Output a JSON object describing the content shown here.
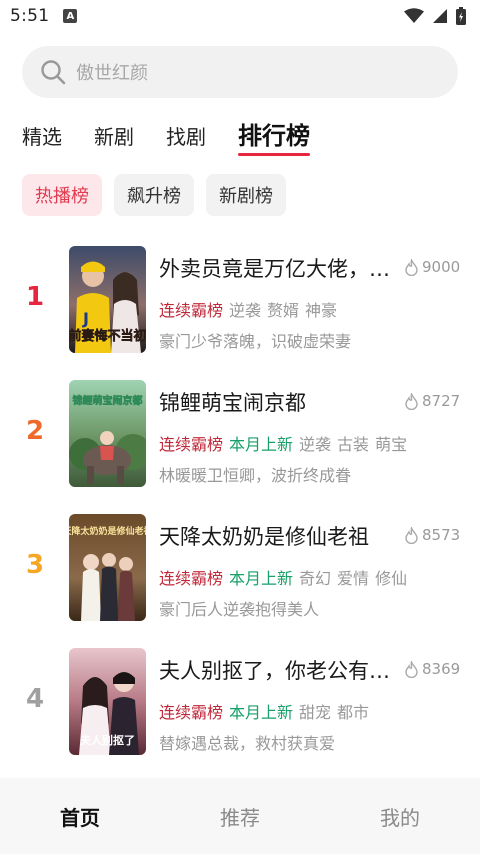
{
  "status_bar": {
    "time": "5:51",
    "notification_letter": "A"
  },
  "search": {
    "placeholder": "傲世红颜"
  },
  "tabs": [
    {
      "label": "精选",
      "active": false
    },
    {
      "label": "新剧",
      "active": false
    },
    {
      "label": "找剧",
      "active": false
    },
    {
      "label": "排行榜",
      "active": true
    }
  ],
  "chips": [
    {
      "label": "热播榜",
      "active": true
    },
    {
      "label": "飙升榜",
      "active": false
    },
    {
      "label": "新剧榜",
      "active": false
    }
  ],
  "colors": {
    "accent": "#e8253f",
    "rank1": "#e8253f",
    "rank2": "#ef6a2a",
    "rank3": "#f5a623",
    "rank4": "#a0a0a0",
    "tag_red": "#c0283a",
    "tag_green": "#18a06a"
  },
  "items": [
    {
      "rank": "1",
      "title": "外卖员竟是万亿大佬，…",
      "heat": "9000",
      "tags": [
        {
          "text": "连续霸榜",
          "type": "red"
        },
        {
          "text": "逆袭",
          "type": "gray"
        },
        {
          "text": "赘婿",
          "type": "gray"
        },
        {
          "text": "神豪",
          "type": "gray"
        }
      ],
      "desc": "豪门少爷落魄，识破虚荣妻",
      "cover_text": "前妻悔不当初"
    },
    {
      "rank": "2",
      "title": "锦鲤萌宝闹京都",
      "heat": "8727",
      "tags": [
        {
          "text": "连续霸榜",
          "type": "red"
        },
        {
          "text": "本月上新",
          "type": "green"
        },
        {
          "text": "逆袭",
          "type": "gray"
        },
        {
          "text": "古装",
          "type": "gray"
        },
        {
          "text": "萌宝",
          "type": "gray"
        }
      ],
      "desc": "林暖暖卫恒卿，波折终成眷",
      "cover_text": "锦鲤萌宝闹京都"
    },
    {
      "rank": "3",
      "title": "天降太奶奶是修仙老祖",
      "heat": "8573",
      "tags": [
        {
          "text": "连续霸榜",
          "type": "red"
        },
        {
          "text": "本月上新",
          "type": "green"
        },
        {
          "text": "奇幻",
          "type": "gray"
        },
        {
          "text": "爱情",
          "type": "gray"
        },
        {
          "text": "修仙",
          "type": "gray"
        }
      ],
      "desc": "豪门后人逆袭抱得美人",
      "cover_text": "天降太奶奶是修仙老祖"
    },
    {
      "rank": "4",
      "title": "夫人别抠了，你老公有…",
      "heat": "8369",
      "tags": [
        {
          "text": "连续霸榜",
          "type": "red"
        },
        {
          "text": "本月上新",
          "type": "green"
        },
        {
          "text": "甜宠",
          "type": "gray"
        },
        {
          "text": "都市",
          "type": "gray"
        }
      ],
      "desc": "替嫁遇总裁，救村获真爱",
      "cover_text": "夫人别抠了"
    }
  ],
  "bottom_nav": [
    {
      "label": "首页",
      "active": true
    },
    {
      "label": "推荐",
      "active": false
    },
    {
      "label": "我的",
      "active": false
    }
  ]
}
